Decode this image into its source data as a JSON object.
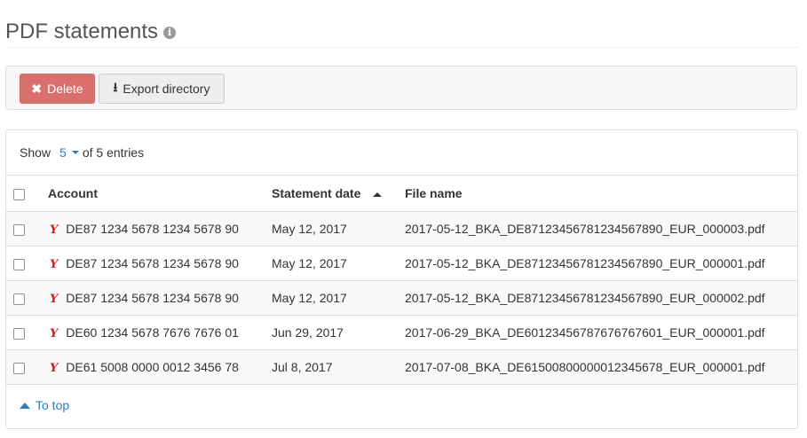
{
  "page": {
    "title": "PDF statements",
    "info_icon": "info-circle-icon"
  },
  "toolbar": {
    "delete_label": "Delete",
    "delete_icon": "x-icon",
    "export_label": "Export directory",
    "export_icon": "download-icon",
    "colors": {
      "delete_bg": "#d9706d",
      "export_bg": "#eeeeee"
    }
  },
  "listing": {
    "show_label": "Show",
    "page_size": "5",
    "entries_suffix": "of 5 entries"
  },
  "table": {
    "columns": {
      "account": "Account",
      "statement_date": "Statement date",
      "file_name": "File name"
    },
    "sort": {
      "column": "statement_date",
      "direction": "ascending"
    },
    "rows": [
      {
        "account": "DE87 1234 5678 1234 5678 90",
        "date": "May 12, 2017",
        "file": "2017-05-12_BKA_DE87123456781234567890_EUR_000003.pdf"
      },
      {
        "account": "DE87 1234 5678 1234 5678 90",
        "date": "May 12, 2017",
        "file": "2017-05-12_BKA_DE87123456781234567890_EUR_000001.pdf"
      },
      {
        "account": "DE87 1234 5678 1234 5678 90",
        "date": "May 12, 2017",
        "file": "2017-05-12_BKA_DE87123456781234567890_EUR_000002.pdf"
      },
      {
        "account": "DE60 1234 5678 7676 7676 01",
        "date": "Jun 29, 2017",
        "file": "2017-06-29_BKA_DE60123456787676767601_EUR_000001.pdf"
      },
      {
        "account": "DE61 5008 0000 0012 3456 78",
        "date": "Jul 8, 2017",
        "file": "2017-07-08_BKA_DE61500800000012345678_EUR_000001.pdf"
      }
    ]
  },
  "footer": {
    "to_top_label": "To top"
  },
  "colors": {
    "link": "#337ab7",
    "bank_icon": "#cc1f1f"
  }
}
